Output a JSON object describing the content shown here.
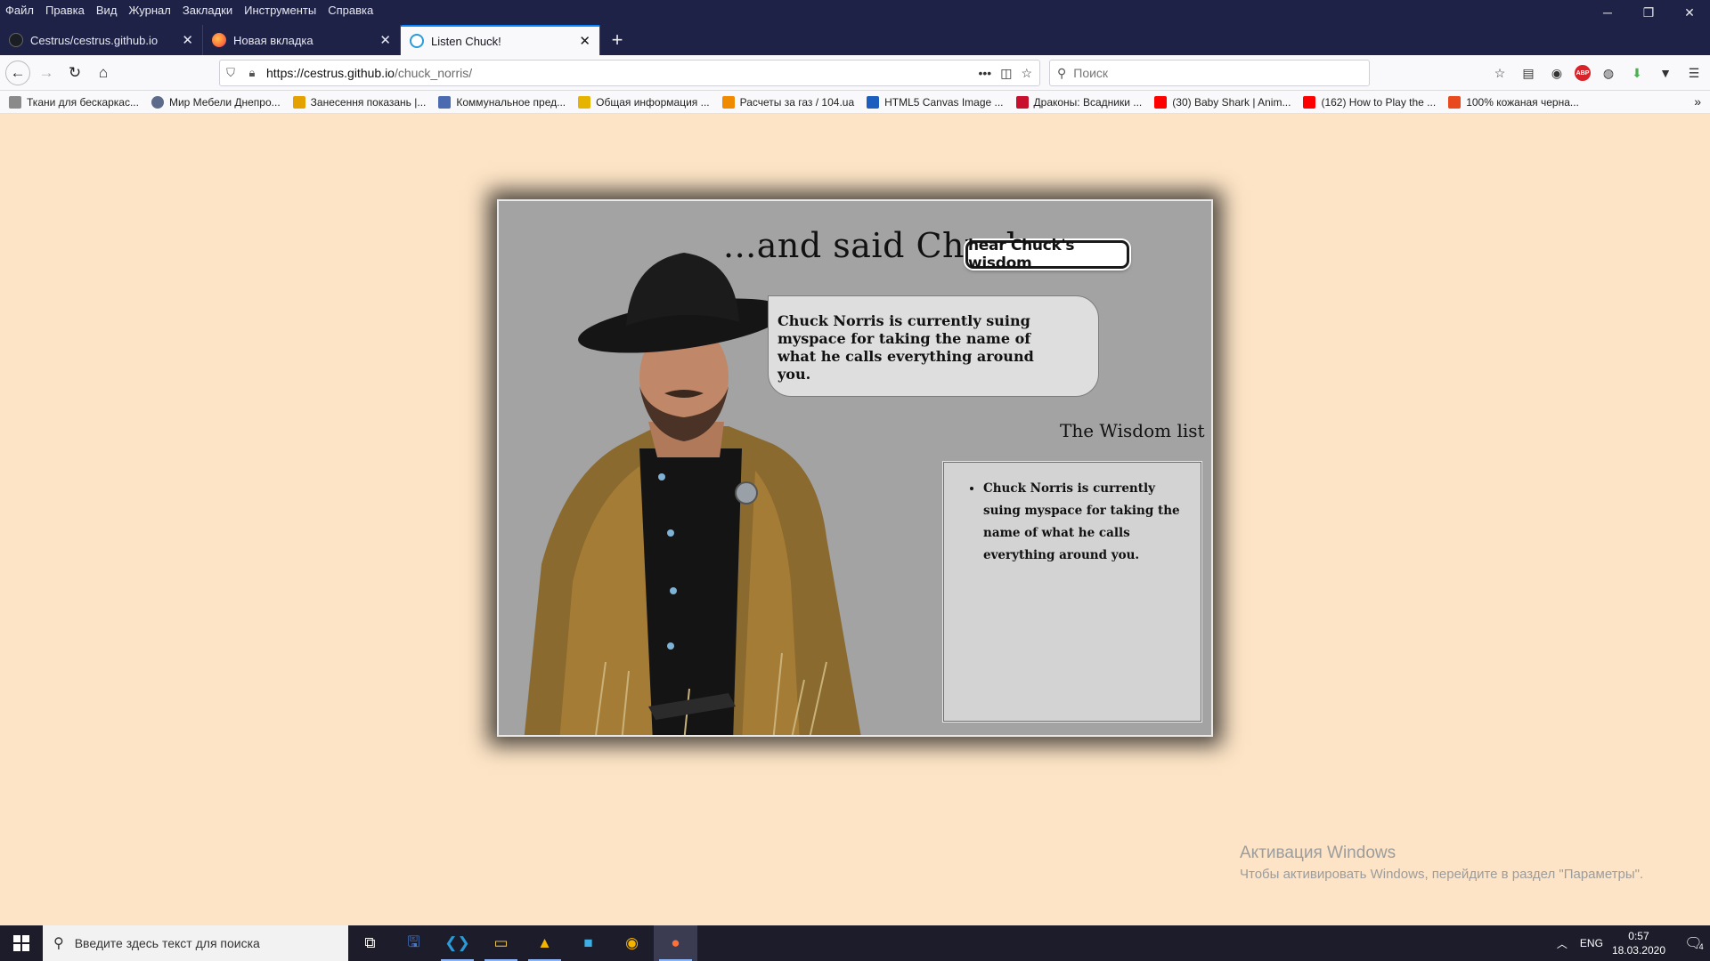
{
  "menu": [
    "Файл",
    "Правка",
    "Вид",
    "Журнал",
    "Закладки",
    "Инструменты",
    "Справка"
  ],
  "tabs": [
    {
      "label": "Cestrus/cestrus.github.io",
      "close": "✕",
      "color": "#1b1f23"
    },
    {
      "label": "Новая вкладка",
      "close": "✕",
      "color": "#ff7139"
    },
    {
      "label": "Listen Chuck!",
      "close": "✕",
      "color": "#2a9bd8"
    }
  ],
  "newtab": "+",
  "address": {
    "host": "https://cestrus.github.io",
    "path": "/chuck_norris/"
  },
  "search_placeholder": "Поиск",
  "bookmarks": [
    {
      "label": "Ткани для бескаркас...",
      "color": "#8a8a8a"
    },
    {
      "label": "Мир Мебели Днепро...",
      "color": "#5d6b8a"
    },
    {
      "label": "Занесення показань |...",
      "color": "#e5a100"
    },
    {
      "label": "Коммунальное пред...",
      "color": "#4b6ab0"
    },
    {
      "label": "Общая информация ...",
      "color": "#e6b400"
    },
    {
      "label": "Расчеты за газ / 104.ua",
      "color": "#f08a00"
    },
    {
      "label": "HTML5 Canvas Image ...",
      "color": "#1b5ebd"
    },
    {
      "label": "Драконы: Всадники ...",
      "color": "#c8102e"
    },
    {
      "label": "(30) Baby Shark | Anim...",
      "color": "#ff0000"
    },
    {
      "label": "(162) How to Play the ...",
      "color": "#ff0000"
    },
    {
      "label": "100% кожаная черна...",
      "color": "#e84a1d"
    }
  ],
  "content": {
    "headline": "...and said Chuck",
    "button": "hear Chuck's wisdom",
    "quote": "Chuck Norris is currently suing myspace for taking the name of what he calls everything around you.",
    "wisdom_title": "The Wisdom list",
    "wisdom_items": [
      "Chuck Norris is currently suing myspace for taking the name of what he calls everything around you."
    ]
  },
  "watermark": {
    "line1": "Активация Windows",
    "line2": "Чтобы активировать Windows, перейдите в раздел \"Параметры\"."
  },
  "taskbar": {
    "search_placeholder": "Введите здесь текст для поиска",
    "lang": "ENG",
    "time": "0:57",
    "date": "18.03.2020",
    "notifications": "4"
  },
  "colors": {
    "page_bg": "#fde4c6",
    "card_bg": "#a3a3a3",
    "chrome_dark": "#1e2246",
    "accent": "#0a84ff"
  }
}
